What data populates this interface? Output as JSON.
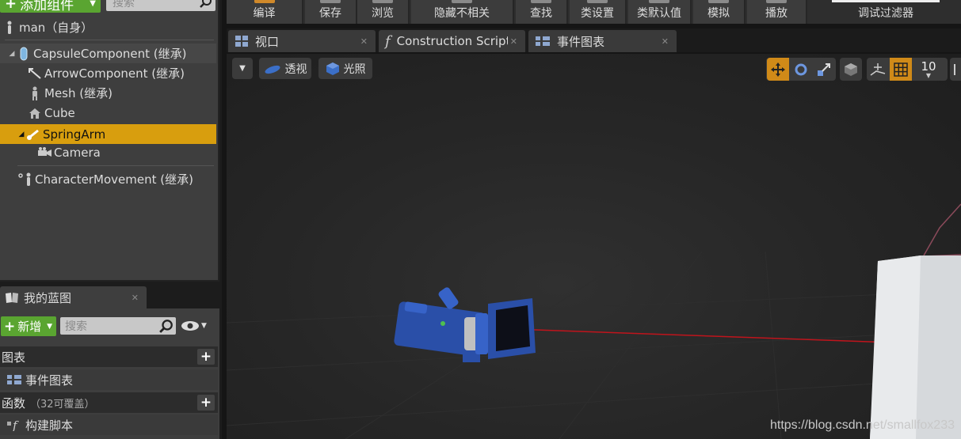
{
  "components": {
    "add_button_label": "添加组件",
    "search_placeholder": "搜索",
    "root_label": "man（自身）",
    "items": [
      {
        "label": "CapsuleComponent (继承)"
      },
      {
        "label": "ArrowComponent (继承)"
      },
      {
        "label": "Mesh (继承)"
      },
      {
        "label": "Cube"
      },
      {
        "label": "SpringArm"
      },
      {
        "label": "Camera"
      },
      {
        "label": "CharacterMovement (继承)"
      }
    ]
  },
  "toolbar": {
    "buttons": [
      {
        "label": "编译"
      },
      {
        "label": "保存"
      },
      {
        "label": "浏览"
      },
      {
        "label": "隐藏不相关"
      },
      {
        "label": "查找"
      },
      {
        "label": "类设置"
      },
      {
        "label": "类默认值"
      },
      {
        "label": "模拟"
      },
      {
        "label": "播放"
      }
    ],
    "filter_label": "调试过滤器"
  },
  "tabs": [
    {
      "label": "视口"
    },
    {
      "label": "Construction Script"
    },
    {
      "label": "事件图表"
    }
  ],
  "viewport": {
    "perspective_label": "透视",
    "lit_label": "光照",
    "grid_snap_value": "10"
  },
  "my_blueprint": {
    "tab_label": "我的蓝图",
    "new_button_label": "新增",
    "search_placeholder": "搜索",
    "sections": [
      {
        "title": "图表",
        "subtitle": "",
        "item": "事件图表"
      },
      {
        "title": "函数",
        "subtitle": "（32可覆盖）",
        "item": "构建脚本"
      }
    ]
  },
  "watermark": "https://blog.csdn.net/smallfox233",
  "colors": {
    "accent_green": "#5aa531",
    "selection_orange": "#d89e0e",
    "camera_blue": "#2a4fa8"
  }
}
